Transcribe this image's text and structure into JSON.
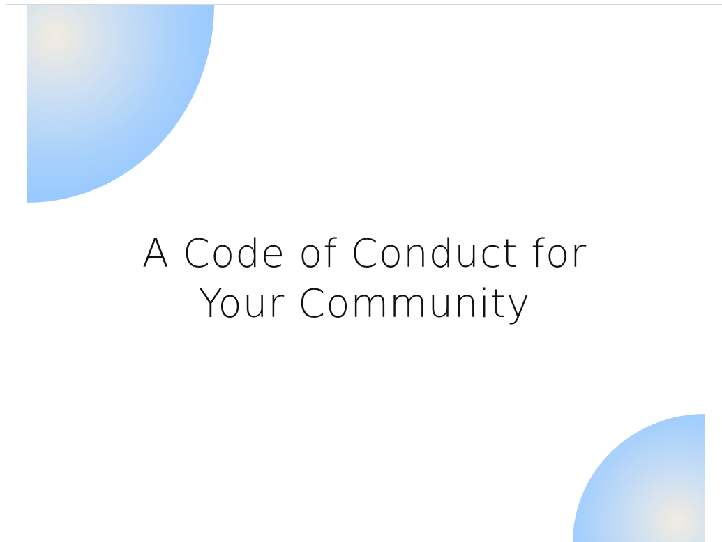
{
  "slide": {
    "title_line_1": "A Code of Conduct for",
    "title_line_2": "Your Community",
    "decoration": {
      "top_left": "quarter-circle-gradient",
      "bottom_right": "quarter-circle-gradient"
    },
    "colors": {
      "background": "#ffffff",
      "circle_edge": "#99caff",
      "circle_center": "#f2ecdf",
      "text": "#111111"
    }
  }
}
